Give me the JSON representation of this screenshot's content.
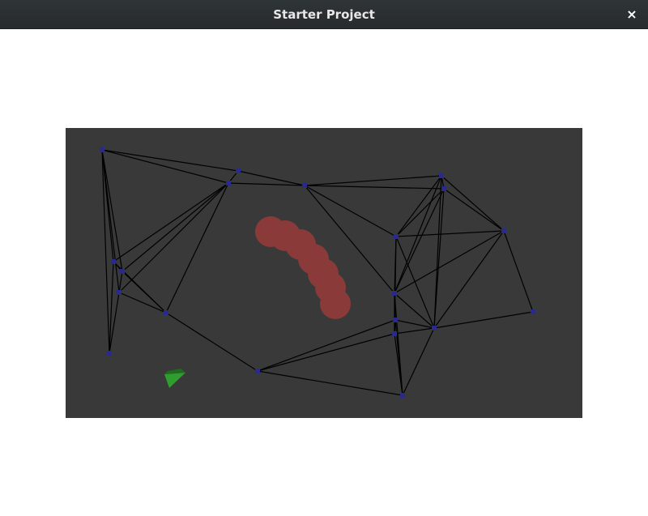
{
  "window": {
    "title": "Starter Project",
    "close_glyph": "×"
  },
  "scene": {
    "background_color": "#393939",
    "edge_color": "#000000",
    "node_color": "#2a2a8a",
    "blob_color": "#8b3a3a",
    "agent_color": "#2e9e2e",
    "icons": {
      "agent": "triangle-agent-icon",
      "close": "close-icon"
    }
  }
}
